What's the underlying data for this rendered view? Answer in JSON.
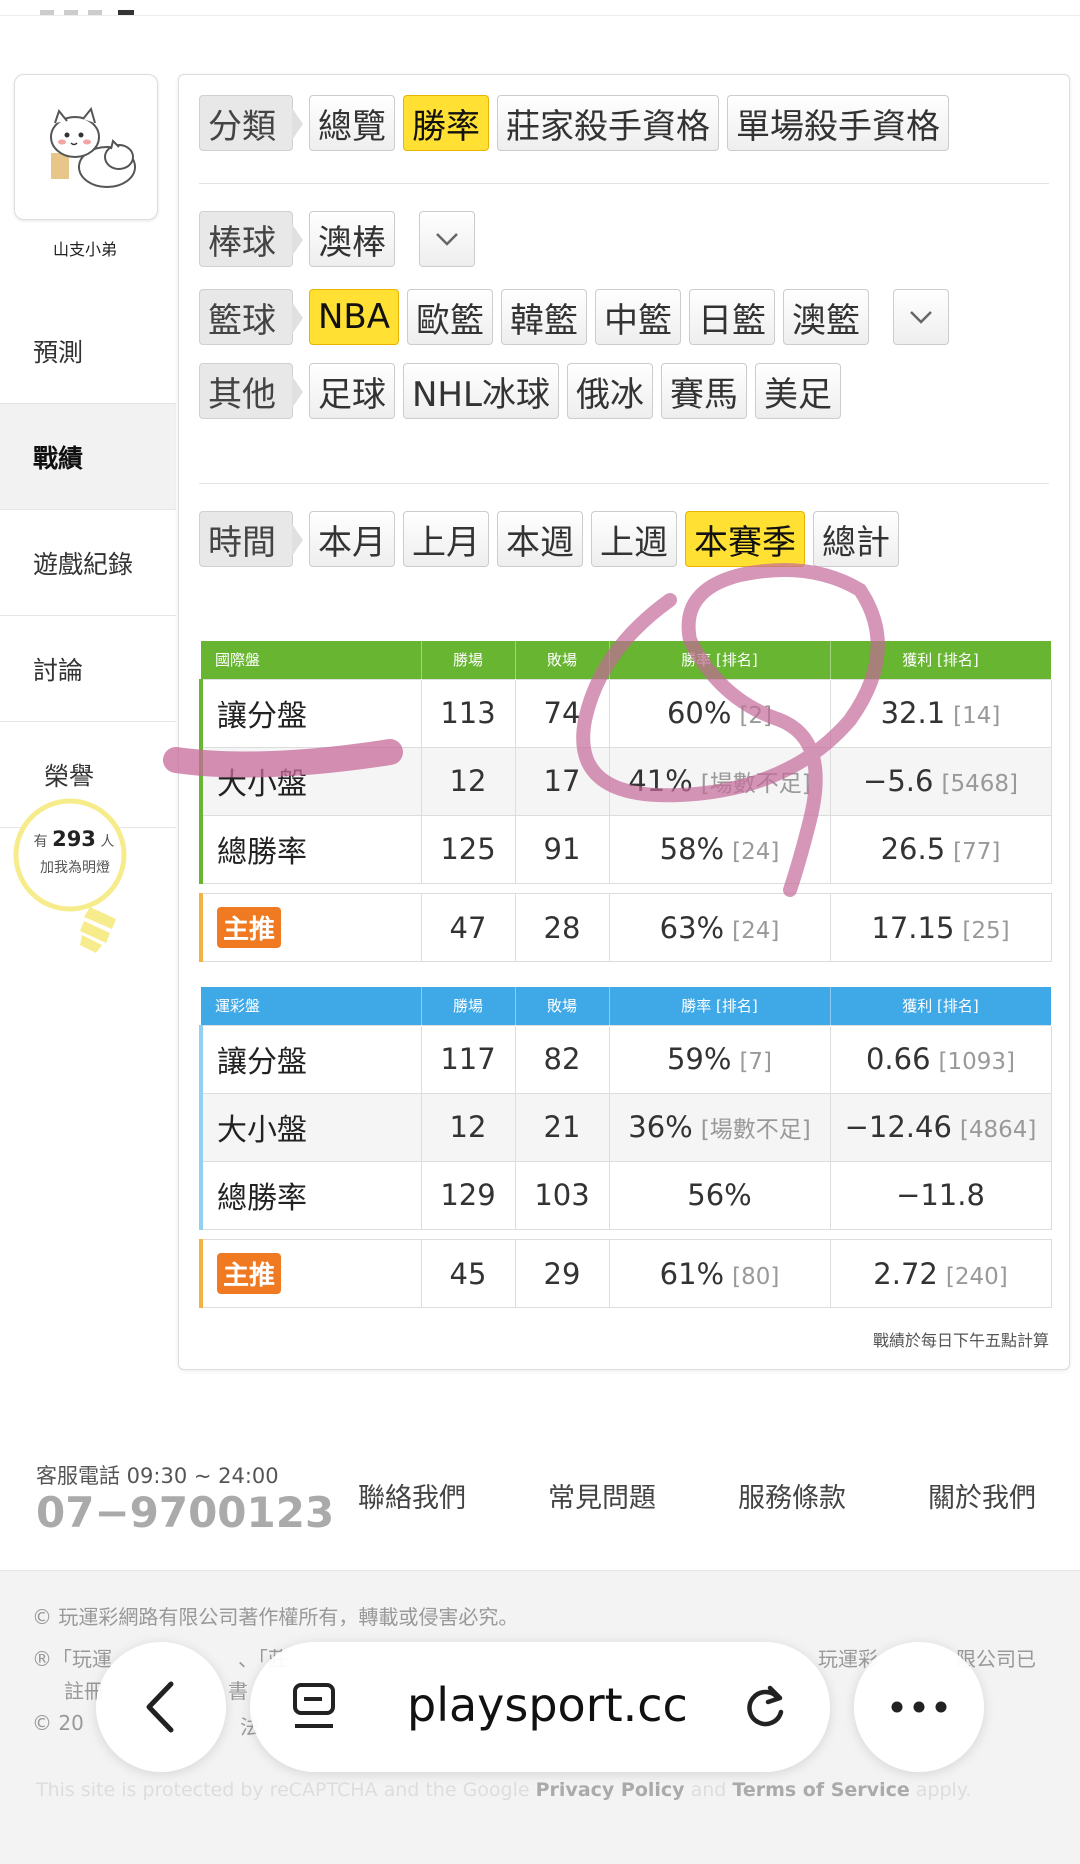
{
  "sidebar": {
    "username": "山支小弟",
    "items": [
      {
        "label": "預測"
      },
      {
        "label": "戰績"
      },
      {
        "label": "遊戲紀錄"
      },
      {
        "label": "討論"
      },
      {
        "label": "榮譽"
      }
    ],
    "lamp": {
      "prefix": "有",
      "count": "293",
      "suffix": "人",
      "caption": "加我為明燈"
    }
  },
  "filters": {
    "category": {
      "label": "分類",
      "options": [
        "總覽",
        "勝率",
        "莊家殺手資格",
        "單場殺手資格"
      ],
      "selected": "勝率"
    },
    "baseball": {
      "label": "棒球",
      "options": [
        "澳棒"
      ]
    },
    "basketball": {
      "label": "籃球",
      "options": [
        "NBA",
        "歐籃",
        "韓籃",
        "中籃",
        "日籃",
        "澳籃"
      ],
      "selected": "NBA"
    },
    "other": {
      "label": "其他",
      "options": [
        "足球",
        "NHL冰球",
        "俄冰",
        "賽馬",
        "美足"
      ]
    },
    "time": {
      "label": "時間",
      "options": [
        "本月",
        "上月",
        "本週",
        "上週",
        "本賽季",
        "總計"
      ],
      "selected": "本賽季"
    }
  },
  "intl_table": {
    "headers": [
      "國際盤",
      "勝場",
      "敗場",
      "勝率 [排名]",
      "獲利 [排名]"
    ],
    "rows": [
      {
        "type": "讓分盤",
        "win": "113",
        "loss": "74",
        "rate": "60%",
        "rate_rank": "[2]",
        "profit": "32.1",
        "profit_rank": "[14]"
      },
      {
        "type": "大小盤",
        "win": "12",
        "loss": "17",
        "rate": "41%",
        "rate_rank": "[場數不足]",
        "profit": "−5.6",
        "profit_rank": "[5468]"
      },
      {
        "type": "總勝率",
        "win": "125",
        "loss": "91",
        "rate": "58%",
        "rate_rank": "[24]",
        "profit": "26.5",
        "profit_rank": "[77]"
      }
    ],
    "featured": {
      "label": "主推",
      "win": "47",
      "loss": "28",
      "rate": "63%",
      "rate_rank": "[24]",
      "profit": "17.15",
      "profit_rank": "[25]"
    }
  },
  "sports_table": {
    "headers": [
      "運彩盤",
      "勝場",
      "敗場",
      "勝率 [排名]",
      "獲利 [排名]"
    ],
    "rows": [
      {
        "type": "讓分盤",
        "win": "117",
        "loss": "82",
        "rate": "59%",
        "rate_rank": "[7]",
        "profit": "0.66",
        "profit_rank": "[1093]"
      },
      {
        "type": "大小盤",
        "win": "12",
        "loss": "21",
        "rate": "36%",
        "rate_rank": "[場數不足]",
        "profit": "−12.46",
        "profit_rank": "[4864]"
      },
      {
        "type": "總勝率",
        "win": "129",
        "loss": "103",
        "rate": "56%",
        "rate_rank": "",
        "profit": "−11.8",
        "profit_rank": ""
      }
    ],
    "featured": {
      "label": "主推",
      "win": "45",
      "loss": "29",
      "rate": "61%",
      "rate_rank": "[80]",
      "profit": "2.72",
      "profit_rank": "[240]"
    }
  },
  "note": "戰績於每日下午五點計算",
  "footer": {
    "service_label": "客服電話 09:30 ~ 24:00",
    "phone": "07−9700123",
    "links": [
      "聯絡我們",
      "常見問題",
      "服務條款",
      "關於我們"
    ],
    "copyright": "© 玩運彩網路有限公司著作權所有，轉載或侵害必究。",
    "trademark_a": "®「玩運",
    "trademark_b": "、「莊",
    "trademark_c": "玩運彩",
    "trademark_d": "限公司已",
    "trademark_line2_a": "註冊",
    "trademark_line2_b": "書",
    "year_a": "© 20",
    "year_b": "法",
    "recaptcha_a": "This site is protected by reCAPTCHA and the Google ",
    "recaptcha_privacy": "Privacy Policy",
    "recaptcha_and": " and ",
    "recaptcha_terms": "Terms of Service",
    "recaptcha_end": " apply."
  },
  "browser": {
    "url": "playsport.cc"
  },
  "colors": {
    "accent": "#ffe033",
    "intl_header": "#67b531",
    "sports_header": "#3fa9e8",
    "badge": "#f07a22",
    "annotation": "#c56a9a"
  }
}
